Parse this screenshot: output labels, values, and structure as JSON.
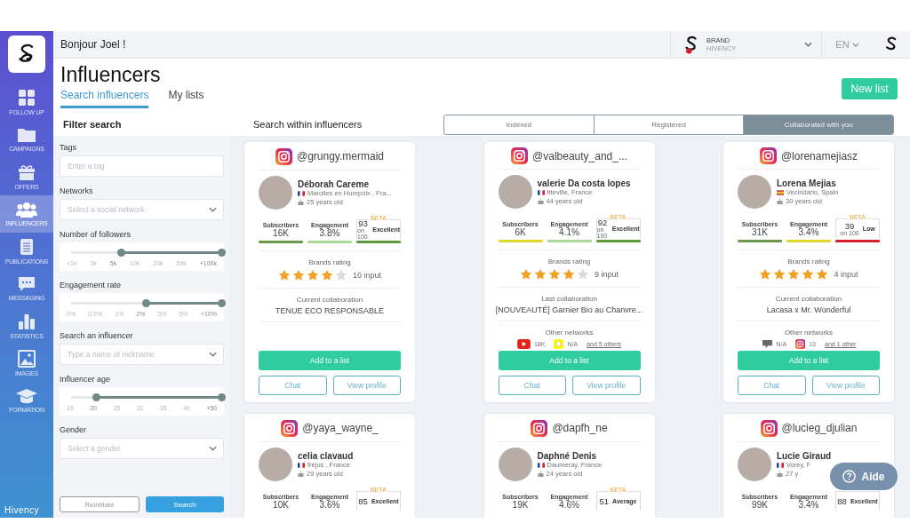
{
  "sidebar": {
    "items": [
      {
        "kind": "grid",
        "label": "FOLLOW UP",
        "selected": false
      },
      {
        "kind": "folder",
        "label": "CAMPAIGNS",
        "selected": false
      },
      {
        "kind": "gift",
        "label": "OFFERS",
        "selected": false
      },
      {
        "kind": "users",
        "label": "INFLUENCERS",
        "selected": true
      },
      {
        "kind": "document",
        "label": "PUBLICATIONS",
        "selected": false
      },
      {
        "kind": "chat",
        "label": "MESSAGING",
        "selected": false
      },
      {
        "kind": "chart",
        "label": "STATISTICS",
        "selected": false
      },
      {
        "kind": "image",
        "label": "IMAGES",
        "selected": false
      },
      {
        "kind": "graduation",
        "label": "FORMATION",
        "selected": false
      }
    ],
    "brand": "Hivency"
  },
  "topbar": {
    "greeting": "Bonjour Joel !",
    "brand_label": "BRAND",
    "brand_name": "HIVENCY",
    "language": "EN"
  },
  "header": {
    "title": "Influencers",
    "tabs": [
      {
        "label": "Search influencers",
        "selected": true
      },
      {
        "label": "My lists",
        "selected": false
      }
    ],
    "new_list_button": "New list"
  },
  "filters": {
    "title": "Filter search",
    "groups": [
      {
        "kind": "text",
        "label": "Tags",
        "placeholder": "Enter a tag"
      },
      {
        "kind": "select",
        "label": "Networks",
        "placeholder": "Select a social network"
      },
      {
        "kind": "range",
        "label": "Number of followers",
        "ticks": [
          {
            "label": "<1k",
            "selected": false
          },
          {
            "label": "2k",
            "selected": false
          },
          {
            "label": "5k",
            "selected": true
          },
          {
            "label": "10k",
            "selected": false
          },
          {
            "label": "20k",
            "selected": false
          },
          {
            "label": "50k",
            "selected": false
          },
          {
            "label": "+100k",
            "selected": true
          }
        ]
      },
      {
        "kind": "range",
        "label": "Engagement rate",
        "ticks": [
          {
            "label": "0%",
            "selected": false
          },
          {
            "label": "0.5%",
            "selected": false
          },
          {
            "label": "1%",
            "selected": false
          },
          {
            "label": "2%",
            "selected": true
          },
          {
            "label": "3%",
            "selected": false
          },
          {
            "label": "5%",
            "selected": false
          },
          {
            "label": "+10%",
            "selected": true
          }
        ]
      },
      {
        "kind": "select",
        "label": "Search an influencer",
        "placeholder": "Type a name or nickname"
      },
      {
        "kind": "range",
        "label": "Influencer age",
        "ticks": [
          {
            "label": "16",
            "selected": false
          },
          {
            "label": "20",
            "selected": true
          },
          {
            "label": "25",
            "selected": false
          },
          {
            "label": "30",
            "selected": false
          },
          {
            "label": "35",
            "selected": false
          },
          {
            "label": "40",
            "selected": false
          },
          {
            "label": "+50",
            "selected": true
          }
        ]
      },
      {
        "kind": "select",
        "label": "Gender",
        "placeholder": "Select a gender"
      }
    ],
    "reset_button": "Reinitiate",
    "search_button": "Search"
  },
  "results": {
    "title": "Search within influencers",
    "segments": [
      {
        "label": "Indexed",
        "selected": false
      },
      {
        "label": "Registered",
        "selected": false
      },
      {
        "label": "Collaborated with you",
        "selected": true
      }
    ],
    "cards": [
      {
        "handle": "@grungy.mermaid",
        "name": "Déborah Careme",
        "flag": {
          "kind": "fr"
        },
        "location": "Marolles en Hurepoix , Fra...",
        "age": "25 years old",
        "stats": [
          {
            "label": "Subscribers",
            "value": "16K",
            "color": "#6a9a4a"
          },
          {
            "label": "Engagement",
            "value": "3.8%",
            "color": "#a8d99a"
          }
        ],
        "score": {
          "badge": "BETA",
          "value": "93",
          "scale": "on 100",
          "rating": "Excellent",
          "color": "#5e9b3c"
        },
        "rating_label": "Brands rating",
        "stars": 4,
        "inputs": "10 input",
        "collaboration_label": "Current collaboration",
        "collaboration": "TENUE ECO RESPONSABLE",
        "buttons": {
          "add": "Add to a list",
          "chat": "Chat",
          "profile": "View profile"
        }
      },
      {
        "handle": "@valbeauty_and_...",
        "name": "valerie Da costa lopes",
        "flag": {
          "kind": "fr"
        },
        "location": "Itteville, France",
        "age": "44 years old",
        "stats": [
          {
            "label": "Subscribers",
            "value": "6K",
            "color": "#e2d52e"
          },
          {
            "label": "Engagement",
            "value": "4.1%",
            "color": "#a8d99a"
          }
        ],
        "score": {
          "badge": "BETA",
          "value": "92",
          "scale": "on 100",
          "rating": "Excellent",
          "color": "#5e9b3c"
        },
        "rating_label": "Brands rating",
        "stars": 4,
        "inputs": "9 input",
        "collaboration_label": "Last collaboration",
        "collaboration": "[NOUVEAUTÉ] Garnier Bio au Chanvre...",
        "networks_label": "Other networks",
        "networks": [
          {
            "kind": "youtube",
            "count": "18K"
          },
          {
            "kind": "snapchat",
            "count": "N/A"
          }
        ],
        "more_networks": "and 5 others",
        "buttons": {
          "add": "Add to a list",
          "chat": "Chat",
          "profile": "View profile"
        }
      },
      {
        "handle": "@lorenamejiasz",
        "name": "Lorena Mejias",
        "flag": {
          "kind": "es"
        },
        "location": "Vecindario, Spain",
        "age": "30 years old",
        "stats": [
          {
            "label": "Subscribers",
            "value": "31K",
            "color": "#6a9a4a"
          },
          {
            "label": "Engagement",
            "value": "3.4%",
            "color": "#e2d52e"
          }
        ],
        "score": {
          "badge": "BETA",
          "value": "39",
          "scale": "on 100",
          "rating": "Low",
          "color": "#d3202c"
        },
        "rating_label": "Brands rating",
        "stars": 5,
        "inputs": "4 input",
        "collaboration_label": "Current collaboration",
        "collaboration": "Lacasa x Mr. Wonderful",
        "networks_label": "Other networks",
        "networks": [
          {
            "kind": "twitch",
            "count": "N/A"
          },
          {
            "kind": "instagram",
            "count": "13"
          }
        ],
        "more_networks": "and 1 other",
        "buttons": {
          "add": "Add to a list",
          "chat": "Chat",
          "profile": "View profile"
        }
      },
      {
        "handle": "@yaya_wayne_",
        "name": "celia clavaud",
        "flag": {
          "kind": "fr"
        },
        "location": "fréjus , France",
        "age": "29 years old",
        "stats": [
          {
            "label": "Subscribers",
            "value": "10K"
          },
          {
            "label": "Engagement",
            "value": "3.6%"
          }
        ],
        "score": {
          "badge": "BETA",
          "value": "85",
          "rating": "Excellent"
        }
      },
      {
        "handle": "@dapfh_ne",
        "name": "Daphné Denis",
        "flag": {
          "kind": "fr"
        },
        "location": "Daumeray, France",
        "age": "24 years old",
        "stats": [
          {
            "label": "Subscribers",
            "value": "19K"
          },
          {
            "label": "Engagement",
            "value": "4.6%"
          }
        ],
        "score": {
          "badge": "BETA",
          "value": "51",
          "rating": "Average"
        }
      },
      {
        "handle": "@lucieg_djulian",
        "name": "Lucie Giraud",
        "flag": {
          "kind": "fr"
        },
        "location": "Vorey, F",
        "age": "27 y",
        "stats": [
          {
            "label": "Subscribers",
            "value": "99K"
          },
          {
            "label": "Engagement",
            "value": "3.4%"
          }
        ],
        "score": {
          "value": "88",
          "rating": "Excellent"
        }
      }
    ]
  },
  "help_button": "Aide"
}
